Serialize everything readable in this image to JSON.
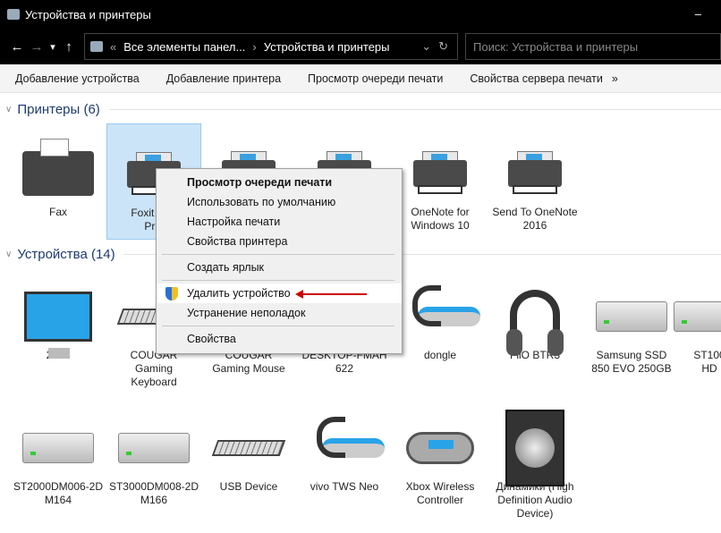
{
  "window": {
    "title": "Устройства и принтеры",
    "minimize": "–"
  },
  "nav": {
    "back": "←",
    "forward": "→",
    "recent": "▾",
    "up": "↑",
    "breadcrumb_prefix": "«",
    "breadcrumb": [
      "Все элементы панел...",
      "Устройства и принтеры"
    ],
    "sep": "›",
    "dropdown": "⌄",
    "refresh": "↻",
    "search_placeholder": "Поиск: Устройства и принтеры"
  },
  "toolbar": {
    "items": [
      "Добавление устройства",
      "Добавление принтера",
      "Просмотр очереди печати",
      "Свойства сервера печати"
    ],
    "more": "»"
  },
  "printers": {
    "header": "Принтеры (6)",
    "items": [
      {
        "lines": [
          "Fax"
        ],
        "icon": "fax"
      },
      {
        "lines": [
          "Foxit Rea",
          "Prin"
        ],
        "icon": "printer",
        "selected": true
      },
      {
        "lines": [
          ""
        ],
        "icon": "printer"
      },
      {
        "lines": [
          ""
        ],
        "icon": "printer"
      },
      {
        "lines": [
          "OneNote for",
          "Windows 10"
        ],
        "icon": "printer"
      },
      {
        "lines": [
          "Send To OneNote",
          "2016"
        ],
        "icon": "printer"
      }
    ]
  },
  "devices": {
    "header": "Устройства (14)",
    "items": [
      {
        "lines": [
          "2790"
        ],
        "icon": "monitor"
      },
      {
        "lines": [
          "COUGAR",
          "Gaming",
          "Keyboard"
        ],
        "icon": "keyboard"
      },
      {
        "lines": [
          "COUGAR",
          "Gaming Mouse"
        ],
        "icon": "mouse"
      },
      {
        "lines": [
          "DESKTOP-FMAH",
          "622"
        ],
        "icon": "computer"
      },
      {
        "lines": [
          "dongle"
        ],
        "icon": "headset-earpiece"
      },
      {
        "lines": [
          "FiiO BTR3"
        ],
        "icon": "headphones"
      },
      {
        "lines": [
          "Samsung SSD",
          "850 EVO 250GB"
        ],
        "icon": "drive"
      },
      {
        "lines": [
          "ST100",
          "HD"
        ],
        "icon": "drive"
      },
      {
        "lines": [
          "ST2000DM006-2D",
          "M164"
        ],
        "icon": "drive"
      },
      {
        "lines": [
          "ST3000DM008-2D",
          "M166"
        ],
        "icon": "drive"
      },
      {
        "lines": [
          "USB Device"
        ],
        "icon": "keyboard"
      },
      {
        "lines": [
          "vivo TWS Neo"
        ],
        "icon": "headset-earpiece"
      },
      {
        "lines": [
          "Xbox Wireless",
          "Controller"
        ],
        "icon": "gamepad"
      },
      {
        "lines": [
          "Динамики (High",
          "Definition Audio",
          "Device)"
        ],
        "icon": "speaker"
      }
    ]
  },
  "context_menu": {
    "items": [
      {
        "label": "Просмотр очереди печати",
        "bold": true
      },
      {
        "label": "Использовать по умолчанию"
      },
      {
        "label": "Настройка печати"
      },
      {
        "label": "Свойства принтера"
      },
      {
        "sep": true
      },
      {
        "label": "Создать ярлык"
      },
      {
        "sep": true
      },
      {
        "label": "Удалить устройство",
        "shield": true,
        "highlight": true
      },
      {
        "label": "Устранение неполадок"
      },
      {
        "sep": true
      },
      {
        "label": "Свойства"
      }
    ]
  },
  "colors": {
    "accent_arrow": "#cc0000",
    "selection": "#cce4f7",
    "titlebar": "#000000"
  }
}
